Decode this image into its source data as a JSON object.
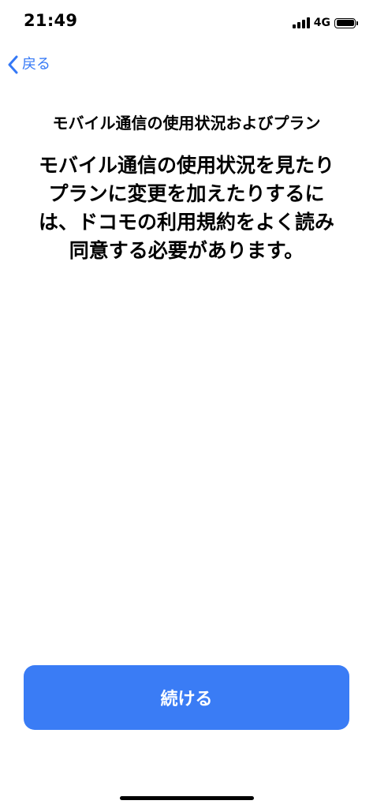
{
  "status_bar": {
    "time": "21:49",
    "network": "4G",
    "signal_bars": 4,
    "battery_level": 1.0,
    "icons": [
      "signal-icon",
      "battery-icon"
    ]
  },
  "nav": {
    "back_label": "戻る",
    "back_icon": "chevron-left-icon"
  },
  "content": {
    "title": "モバイル通信の使用状況およびプラン",
    "message_lines": [
      "モバイル通信の使用状況を見たり",
      "プランに変更を加えたりするに",
      "は、ドコモの利用規約をよく読み",
      "同意する必要があります。"
    ]
  },
  "footer": {
    "continue_label": "続ける"
  },
  "colors": {
    "accent": "#3478F6",
    "button": "#3A7CF5",
    "text": "#000000",
    "background": "#FFFFFF"
  }
}
